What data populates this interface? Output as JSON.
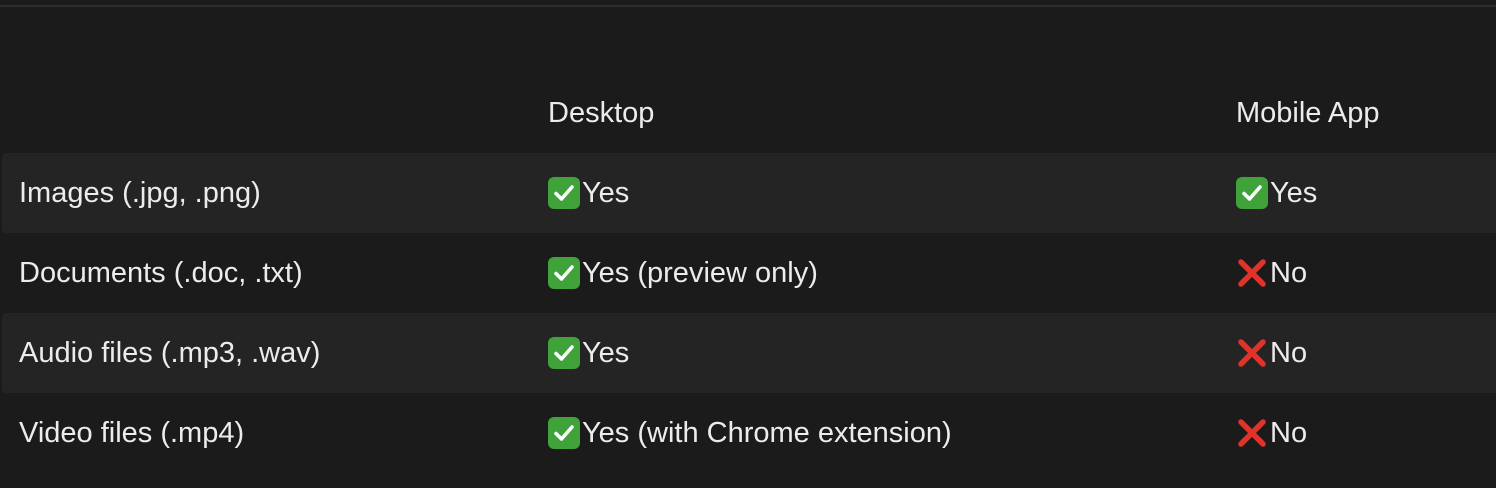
{
  "table": {
    "headers": [
      "",
      "Desktop",
      "Mobile App"
    ],
    "rows": [
      {
        "label": "Images (.jpg, .png)",
        "desktop": {
          "icon": "check-icon",
          "text": "Yes"
        },
        "mobile": {
          "icon": "check-icon",
          "text": "Yes"
        }
      },
      {
        "label": "Documents (.doc, .txt)",
        "desktop": {
          "icon": "check-icon",
          "text": "Yes (preview only)"
        },
        "mobile": {
          "icon": "cross-icon",
          "text": "No"
        }
      },
      {
        "label": "Audio files (.mp3, .wav)",
        "desktop": {
          "icon": "check-icon",
          "text": "Yes"
        },
        "mobile": {
          "icon": "cross-icon",
          "text": "No"
        }
      },
      {
        "label": "Video files (.mp4)",
        "desktop": {
          "icon": "check-icon",
          "text": "Yes (with Chrome extension)"
        },
        "mobile": {
          "icon": "cross-icon",
          "text": "No"
        }
      }
    ]
  },
  "colors": {
    "background": "#1c1b1c",
    "row_shade": "#242424",
    "text": "#ececec",
    "check_green": "#40a33a",
    "cross_red": "#e0342b"
  }
}
